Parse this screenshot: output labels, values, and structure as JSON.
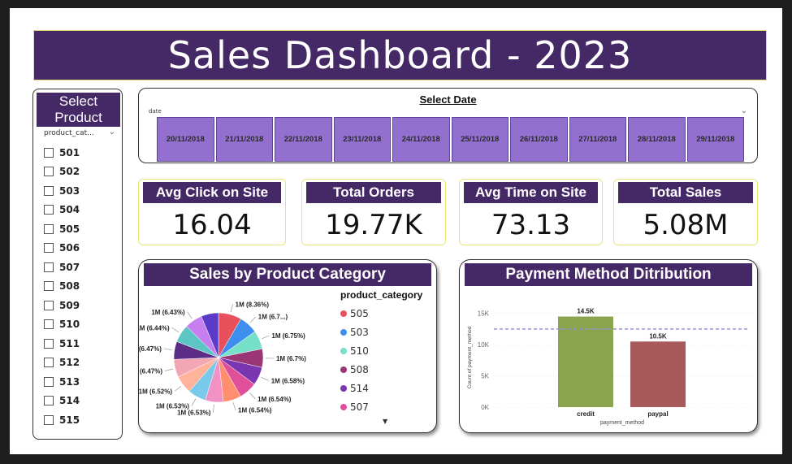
{
  "title": "Sales Dashboard - 2023",
  "product_slicer": {
    "header": "Select Product",
    "field": "product_cat...",
    "items": [
      "501",
      "502",
      "503",
      "504",
      "505",
      "506",
      "507",
      "508",
      "509",
      "510",
      "511",
      "512",
      "513",
      "514",
      "515"
    ]
  },
  "date_slicer": {
    "label": "Select Date",
    "field": "date",
    "dates": [
      "20/11/2018",
      "21/11/2018",
      "22/11/2018",
      "23/11/2018",
      "24/11/2018",
      "25/11/2018",
      "26/11/2018",
      "27/11/2018",
      "28/11/2018",
      "29/11/2018"
    ]
  },
  "kpis": [
    {
      "label": "Avg Click on Site",
      "value": "16.04"
    },
    {
      "label": "Total Orders",
      "value": "19.77K"
    },
    {
      "label": "Avg Time on Site",
      "value": "73.13"
    },
    {
      "label": "Total Sales",
      "value": "5.08M"
    }
  ],
  "colors": {
    "header": "#452866",
    "accent_border": "#e3d97a",
    "date_tile": "#9370cf",
    "bar_credit": "#8aa54d",
    "bar_paypal": "#a85a5a",
    "avg_line": "#9b8fd6"
  },
  "chart_data": [
    {
      "type": "pie",
      "title": "Sales by Product Category",
      "legend_title": "product_category",
      "legend_visible": [
        "505",
        "503",
        "510",
        "508",
        "514",
        "507"
      ],
      "slices": [
        {
          "name": "505",
          "label": "1M (8.36%)",
          "percent": 8.36,
          "color": "#e8505b"
        },
        {
          "name": "503",
          "label": "1M (6.7...)",
          "percent": 6.75,
          "color": "#3e8ef0"
        },
        {
          "name": "510",
          "label": "1M (6.75%)",
          "percent": 6.75,
          "color": "#76e0c8"
        },
        {
          "name": "508",
          "label": "1M (6.7%)",
          "percent": 6.7,
          "color": "#9a3576"
        },
        {
          "name": "514",
          "label": "1M (6.58%)",
          "percent": 6.58,
          "color": "#7a35b0"
        },
        {
          "name": "507",
          "label": "1M (6.54%)",
          "percent": 6.54,
          "color": "#e0509a"
        },
        {
          "name": "",
          "label": "1M (6.54%)",
          "percent": 6.54,
          "color": "#ff8f6e"
        },
        {
          "name": "",
          "label": "1M (6.53%)",
          "percent": 6.53,
          "color": "#f291c6"
        },
        {
          "name": "",
          "label": "1M (6.53%)",
          "percent": 6.53,
          "color": "#7ac8ea"
        },
        {
          "name": "",
          "label": "1M (6.52%)",
          "percent": 6.52,
          "color": "#ffb39a"
        },
        {
          "name": "",
          "label": "1M (6.47%)",
          "percent": 6.47,
          "color": "#f3a6b4"
        },
        {
          "name": "",
          "label": "1M (6.47%)",
          "percent": 6.47,
          "color": "#5b2d86"
        },
        {
          "name": "",
          "label": "1M (6.44%)",
          "percent": 6.44,
          "color": "#5cc6c4"
        },
        {
          "name": "",
          "label": "1M (6.43%)",
          "percent": 6.43,
          "color": "#c77ff0"
        },
        {
          "name": "",
          "label": "",
          "percent": 6.29,
          "color": "#5a3bc8"
        }
      ]
    },
    {
      "type": "bar",
      "title": "Payment Method Ditribution",
      "categories": [
        "credit",
        "paypal"
      ],
      "values": [
        14.5,
        10.5
      ],
      "value_labels": [
        "14.5K",
        "10.5K"
      ],
      "xlabel": "payment_method",
      "ylabel": "Count of payment_method",
      "yticks": [
        "0K",
        "5K",
        "10K",
        "15K"
      ],
      "ylim": [
        0,
        16
      ],
      "average_line": 12.5
    }
  ]
}
